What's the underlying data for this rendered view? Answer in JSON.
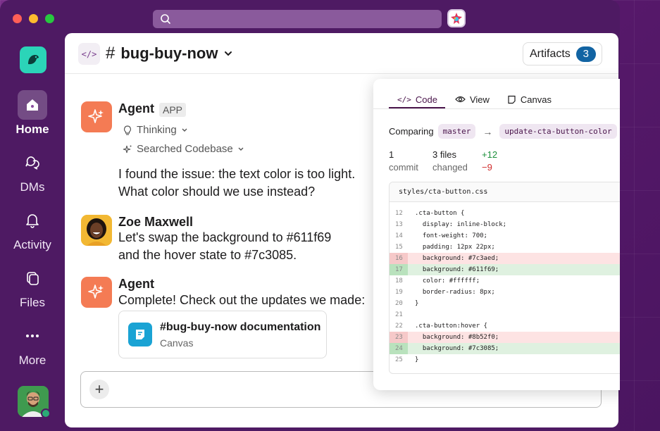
{
  "sidebar": {
    "items": [
      {
        "label": "Home",
        "icon": "home-icon",
        "active": true
      },
      {
        "label": "DMs",
        "icon": "dms-icon",
        "active": false
      },
      {
        "label": "Activity",
        "icon": "bell-icon",
        "active": false
      },
      {
        "label": "Files",
        "icon": "files-icon",
        "active": false
      },
      {
        "label": "More",
        "icon": "more-icon",
        "active": false
      }
    ]
  },
  "header": {
    "channel_name": "bug-buy-now",
    "artifacts_label": "Artifacts",
    "artifacts_count": "3"
  },
  "messages": [
    {
      "sender": "Agent",
      "tag": "APP",
      "thinking": "Thinking",
      "searched": "Searched Codebase",
      "line1": "I found the issue: the text color is too light.",
      "line2": "What color should we use instead?"
    },
    {
      "sender": "Zoe Maxwell",
      "line1": "Let's swap the background to #611f69",
      "line2": "and the hover state to #7c3085."
    },
    {
      "sender": "Agent",
      "line1": "Complete! Check out the updates we made:",
      "card_title": "#bug-buy-now documentation",
      "card_subtitle": "Canvas"
    }
  ],
  "panel": {
    "tabs": [
      {
        "label": "Code",
        "icon": "code-icon"
      },
      {
        "label": "View",
        "icon": "eye-icon"
      },
      {
        "label": "Canvas",
        "icon": "canvas-icon"
      }
    ],
    "comparing_label": "Comparing",
    "base_branch": "master",
    "head_branch": "update-cta-button-color",
    "commits_num": "1",
    "commits_label": "commit",
    "files_num": "3 files",
    "files_label": "changed",
    "additions": "+12",
    "deletions": "−9",
    "file_name": "styles/cta-button.css",
    "lines": [
      {
        "n": "12",
        "code": ".cta-button {",
        "type": "ctx"
      },
      {
        "n": "13",
        "code": "  display: inline-block;",
        "type": "ctx"
      },
      {
        "n": "14",
        "code": "  font-weight: 700;",
        "type": "ctx"
      },
      {
        "n": "15",
        "code": "  padding: 12px 22px;",
        "type": "ctx"
      },
      {
        "n": "16",
        "code": "  background: #7c3aed;",
        "type": "del"
      },
      {
        "n": "17",
        "code": "  background: #611f69;",
        "type": "add"
      },
      {
        "n": "18",
        "code": "  color: #ffffff;",
        "type": "ctx"
      },
      {
        "n": "19",
        "code": "  border-radius: 8px;",
        "type": "ctx"
      },
      {
        "n": "20",
        "code": "}",
        "type": "ctx"
      },
      {
        "n": "21",
        "code": "",
        "type": "ctx"
      },
      {
        "n": "22",
        "code": ".cta-button:hover {",
        "type": "ctx"
      },
      {
        "n": "23",
        "code": "  background: #8b52f0;",
        "type": "del"
      },
      {
        "n": "24",
        "code": "  background: #7c3085;",
        "type": "add"
      },
      {
        "n": "25",
        "code": "}",
        "type": "ctx"
      }
    ]
  }
}
